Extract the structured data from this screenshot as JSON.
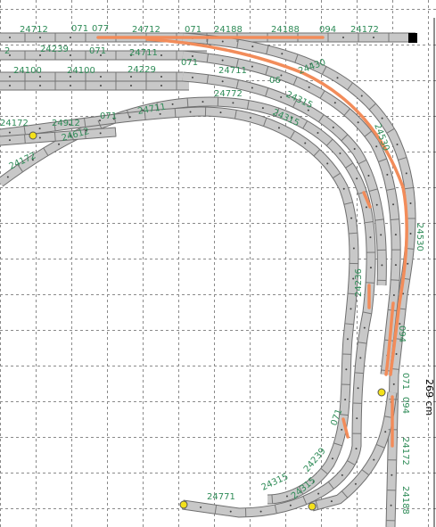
{
  "labels": {
    "l1": "24712",
    "l2": "071",
    "l3": "077",
    "l4": "24712",
    "l5": "071",
    "l6": "24188",
    "l7": "24188",
    "l8": "094",
    "l9": "24172",
    "l10": "24239",
    "l11": "071",
    "l12": "24711",
    "l13": "24100",
    "l14": "24100",
    "l15": "24229",
    "l16": "071",
    "l17": "24711",
    "l18": "24430",
    "l19": "06",
    "l20": "24315",
    "l21": "24172",
    "l22": "24912",
    "l23": "071",
    "l24": "24711",
    "l25": "24772",
    "l26": "24315",
    "l27": "24612",
    "l28": "24172",
    "l29": "24530",
    "l30": "24530",
    "l31": "24236",
    "l32": "094",
    "l33": "071",
    "l34": "071",
    "l35": "094",
    "l36": "24172",
    "l37": "24188",
    "l38": "24239",
    "l39": "24315",
    "l40": "24771",
    "l41": "24315",
    "l42": "071",
    "l43": "2",
    "l44": "24188"
  },
  "dimension": "269 cm",
  "colors": {
    "route": "#f28c5a",
    "track": "#c8c8c8",
    "label": "#2e8b57",
    "marker": "#f4e11a"
  }
}
